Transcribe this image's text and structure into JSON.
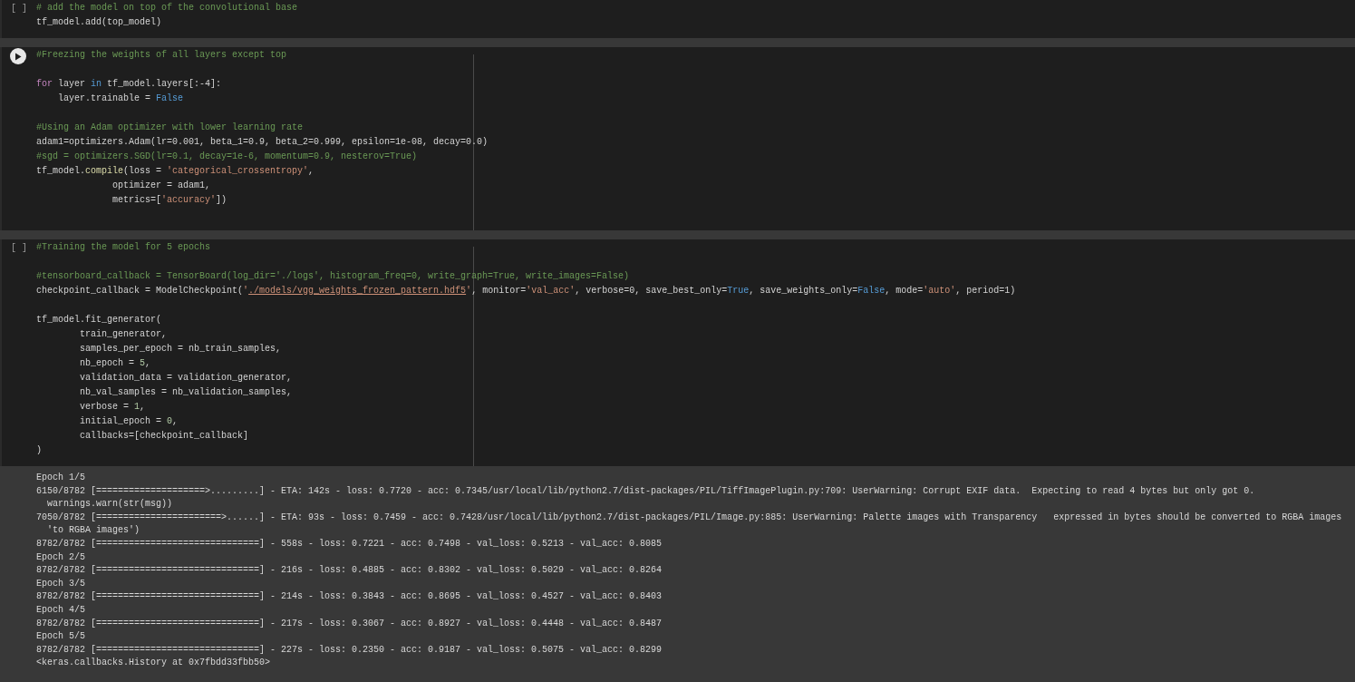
{
  "cells": [
    {
      "run": {
        "kind": "brackets",
        "label": "[ ]"
      },
      "ruler": false,
      "blocks": [
        [
          {
            "tokens": [
              {
                "kind": "comment",
                "t": "# add the model on top of the convolutional base"
              }
            ]
          },
          {
            "tokens": [
              {
                "kind": "plain",
                "t": "tf_model.add(top_model)"
              }
            ]
          }
        ]
      ]
    },
    {
      "run": {
        "kind": "play"
      },
      "ruler": true,
      "blocks": [
        [
          {
            "tokens": [
              {
                "kind": "comment",
                "t": "#Freezing the weights of all layers except top"
              }
            ]
          }
        ],
        [
          {
            "tokens": [
              {
                "kind": "keyword",
                "t": "for"
              },
              {
                "kind": "plain",
                "t": " layer "
              },
              {
                "kind": "builtin",
                "t": "in"
              },
              {
                "kind": "plain",
                "t": " tf_model.layers[:-4]:"
              }
            ]
          },
          {
            "tokens": [
              {
                "kind": "plain",
                "t": "    layer.trainable = "
              },
              {
                "kind": "builtin",
                "t": "False"
              }
            ]
          }
        ],
        [
          {
            "tokens": [
              {
                "kind": "comment",
                "t": "#Using an Adam optimizer with lower learning rate"
              }
            ]
          },
          {
            "tokens": [
              {
                "kind": "plain",
                "t": "adam1=optimizers.Adam(lr=0.001, beta_1=0.9, beta_2=0.999, epsilon=1e-08, decay=0.0)"
              }
            ]
          },
          {
            "tokens": [
              {
                "kind": "comment",
                "t": "#sgd = optimizers.SGD(lr=0.1, decay=1e-6, momentum=0.9, nesterov=True)"
              }
            ]
          },
          {
            "tokens": [
              {
                "kind": "plain",
                "t": "tf_model."
              },
              {
                "kind": "function",
                "t": "compile"
              },
              {
                "kind": "plain",
                "t": "(loss = "
              },
              {
                "kind": "string",
                "t": "'categorical_crossentropy'"
              },
              {
                "kind": "plain",
                "t": ","
              }
            ]
          },
          {
            "tokens": [
              {
                "kind": "plain",
                "t": "              optimizer = adam1,"
              }
            ]
          },
          {
            "tokens": [
              {
                "kind": "plain",
                "t": "              metrics=["
              },
              {
                "kind": "string",
                "t": "'accuracy'"
              },
              {
                "kind": "plain",
                "t": "])"
              }
            ]
          }
        ]
      ]
    },
    {
      "run": {
        "kind": "brackets",
        "label": "[ ]"
      },
      "ruler": true,
      "blocks": [
        [
          {
            "tokens": [
              {
                "kind": "comment",
                "t": "#Training the model for 5 epochs"
              }
            ]
          }
        ],
        [
          {
            "tokens": [
              {
                "kind": "comment",
                "t": "#tensorboard_callback = TensorBoard(log_dir='./logs', histogram_freq=0, write_graph=True, write_images=False)"
              }
            ]
          },
          {
            "tokens": [
              {
                "kind": "plain",
                "t": "checkpoint_callback = ModelCheckpoint("
              },
              {
                "kind": "string",
                "t": "'"
              },
              {
                "kind": "link",
                "t": "./models/vgg_weights_frozen_pattern.hdf5"
              },
              {
                "kind": "string",
                "t": "'"
              },
              {
                "kind": "plain",
                "t": ", monitor="
              },
              {
                "kind": "string",
                "t": "'val_acc'"
              },
              {
                "kind": "plain",
                "t": ", verbose=0, save_best_only="
              },
              {
                "kind": "builtin",
                "t": "True"
              },
              {
                "kind": "plain",
                "t": ", save_weights_only="
              },
              {
                "kind": "builtin",
                "t": "False"
              },
              {
                "kind": "plain",
                "t": ", mode="
              },
              {
                "kind": "string",
                "t": "'auto'"
              },
              {
                "kind": "plain",
                "t": ", period=1)"
              }
            ]
          }
        ],
        [
          {
            "tokens": [
              {
                "kind": "plain",
                "t": "tf_model.fit_generator("
              }
            ]
          },
          {
            "tokens": [
              {
                "kind": "plain",
                "t": "        train_generator,"
              }
            ]
          },
          {
            "tokens": [
              {
                "kind": "plain",
                "t": "        samples_per_epoch = nb_train_samples,"
              }
            ]
          },
          {
            "tokens": [
              {
                "kind": "plain",
                "t": "        nb_epoch = "
              },
              {
                "kind": "number",
                "t": "5"
              },
              {
                "kind": "plain",
                "t": ","
              }
            ]
          },
          {
            "tokens": [
              {
                "kind": "plain",
                "t": "        validation_data = validation_generator,"
              }
            ]
          },
          {
            "tokens": [
              {
                "kind": "plain",
                "t": "        nb_val_samples = nb_validation_samples,"
              }
            ]
          },
          {
            "tokens": [
              {
                "kind": "plain",
                "t": "        verbose = "
              },
              {
                "kind": "number",
                "t": "1"
              },
              {
                "kind": "plain",
                "t": ","
              }
            ]
          },
          {
            "tokens": [
              {
                "kind": "plain",
                "t": "        initial_epoch = "
              },
              {
                "kind": "number",
                "t": "0"
              },
              {
                "kind": "plain",
                "t": ","
              }
            ]
          },
          {
            "tokens": [
              {
                "kind": "plain",
                "t": "        callbacks=[checkpoint_callback]"
              }
            ]
          },
          {
            "tokens": [
              {
                "kind": "plain",
                "t": ")"
              }
            ]
          }
        ]
      ],
      "output": [
        "Epoch 1/5",
        "6150/8782 [====================>.........] - ETA: 142s - loss: 0.7720 - acc: 0.7345/usr/local/lib/python2.7/dist-packages/PIL/TiffImagePlugin.py:709: UserWarning: Corrupt EXIF data.  Expecting to read 4 bytes but only got 0.",
        "  warnings.warn(str(msg))",
        "7050/8782 [=======================>......] - ETA: 93s - loss: 0.7459 - acc: 0.7428/usr/local/lib/python2.7/dist-packages/PIL/Image.py:885: UserWarning: Palette images with Transparency   expressed in bytes should be converted to RGBA images",
        "  'to RGBA images')",
        "8782/8782 [==============================] - 558s - loss: 0.7221 - acc: 0.7498 - val_loss: 0.5213 - val_acc: 0.8085",
        "Epoch 2/5",
        "8782/8782 [==============================] - 216s - loss: 0.4885 - acc: 0.8302 - val_loss: 0.5029 - val_acc: 0.8264",
        "Epoch 3/5",
        "8782/8782 [==============================] - 214s - loss: 0.3843 - acc: 0.8695 - val_loss: 0.4527 - val_acc: 0.8403",
        "Epoch 4/5",
        "8782/8782 [==============================] - 217s - loss: 0.3067 - acc: 0.8927 - val_loss: 0.4448 - val_acc: 0.8487",
        "Epoch 5/5",
        "8782/8782 [==============================] - 227s - loss: 0.2350 - acc: 0.9187 - val_loss: 0.5075 - val_acc: 0.8299",
        "<keras.callbacks.History at 0x7fbdd33fbb50>"
      ]
    }
  ]
}
